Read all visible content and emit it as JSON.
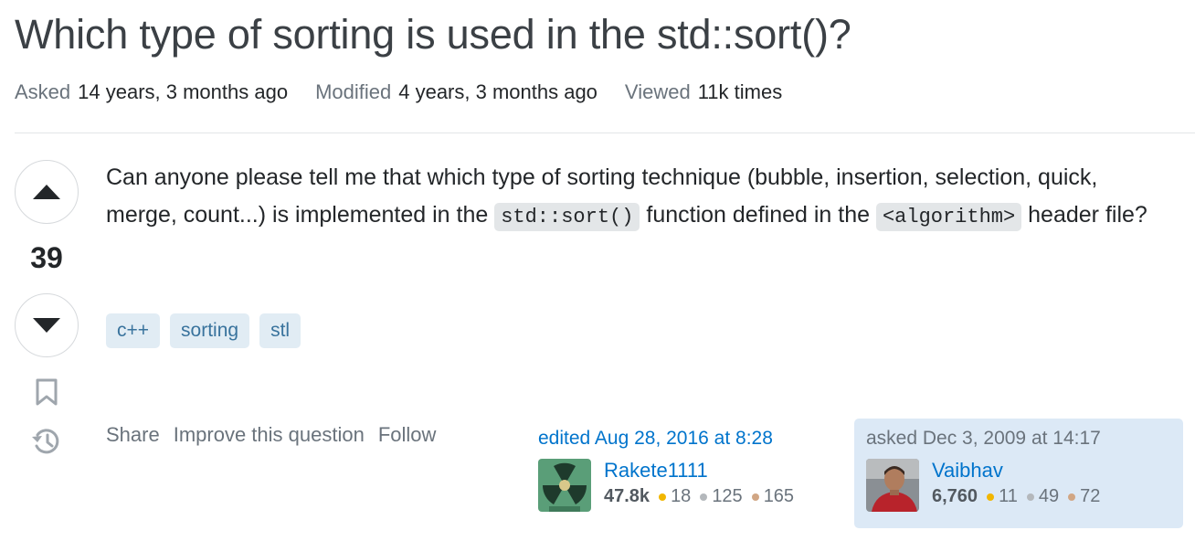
{
  "question": {
    "title": "Which type of sorting is used in the std::sort()?",
    "meta": {
      "asked_label": "Asked",
      "asked_value": "14 years, 3 months ago",
      "modified_label": "Modified",
      "modified_value": "4 years, 3 months ago",
      "viewed_label": "Viewed",
      "viewed_value": "11k times"
    },
    "votes": "39",
    "body": {
      "part1": "Can anyone please tell me that which type of sorting technique (bubble, insertion, selection, quick, merge, count...) is implemented in the ",
      "code1": "std::sort()",
      "part2": " function defined in the ",
      "code2": "<algorithm>",
      "part3": " header file?"
    },
    "tags": [
      "c++",
      "sorting",
      "stl"
    ],
    "actions": {
      "share": "Share",
      "improve": "Improve this question",
      "follow": "Follow"
    },
    "editor": {
      "time": "edited Aug 28, 2016 at 8:28",
      "name": "Rakete1111",
      "reputation": "47.8k",
      "gold": "18",
      "silver": "125",
      "bronze": "165"
    },
    "asker": {
      "time": "asked Dec 3, 2009 at 14:17",
      "name": "Vaibhav",
      "reputation": "6,760",
      "gold": "11",
      "silver": "49",
      "bronze": "72"
    }
  },
  "icons": {
    "upvote": "triangle-up-icon",
    "downvote": "triangle-down-icon",
    "bookmark": "bookmark-icon",
    "history": "history-icon"
  },
  "colors": {
    "link": "#0074cc",
    "tag_bg": "#e1ecf4",
    "tag_text": "#39739d",
    "asker_card_bg": "#dce9f6",
    "gold": "#f1b600",
    "silver": "#b4b8bc",
    "bronze": "#d1a684"
  }
}
